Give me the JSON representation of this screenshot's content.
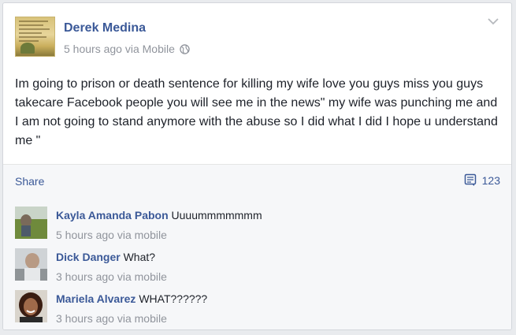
{
  "post": {
    "author": "Derek Medina",
    "meta": "5 hours ago via Mobile",
    "privacy_icon": "globe-icon",
    "text": "Im going to prison or death sentence for killing my wife love you guys miss you guys takecare Facebook people you will see me in the news\" my wife was punching me and I am not going to stand anymore with the abuse so I did what I did I hope u understand me \""
  },
  "actions": {
    "share_label": "Share",
    "comment_count": "123"
  },
  "comments": [
    {
      "name": "Kayla Amanda Pabon",
      "text": "Uuuummmmmmm",
      "meta": "5 hours ago via mobile"
    },
    {
      "name": "Dick Danger",
      "text": "What?",
      "meta": "3 hours ago via mobile"
    },
    {
      "name": "Mariela Alvarez",
      "text": "WHAT??????",
      "meta": "3 hours ago via mobile"
    }
  ],
  "colors": {
    "link": "#3b5998",
    "meta": "#90949c",
    "text": "#1d2129",
    "footer_bg": "#f6f7f9"
  }
}
